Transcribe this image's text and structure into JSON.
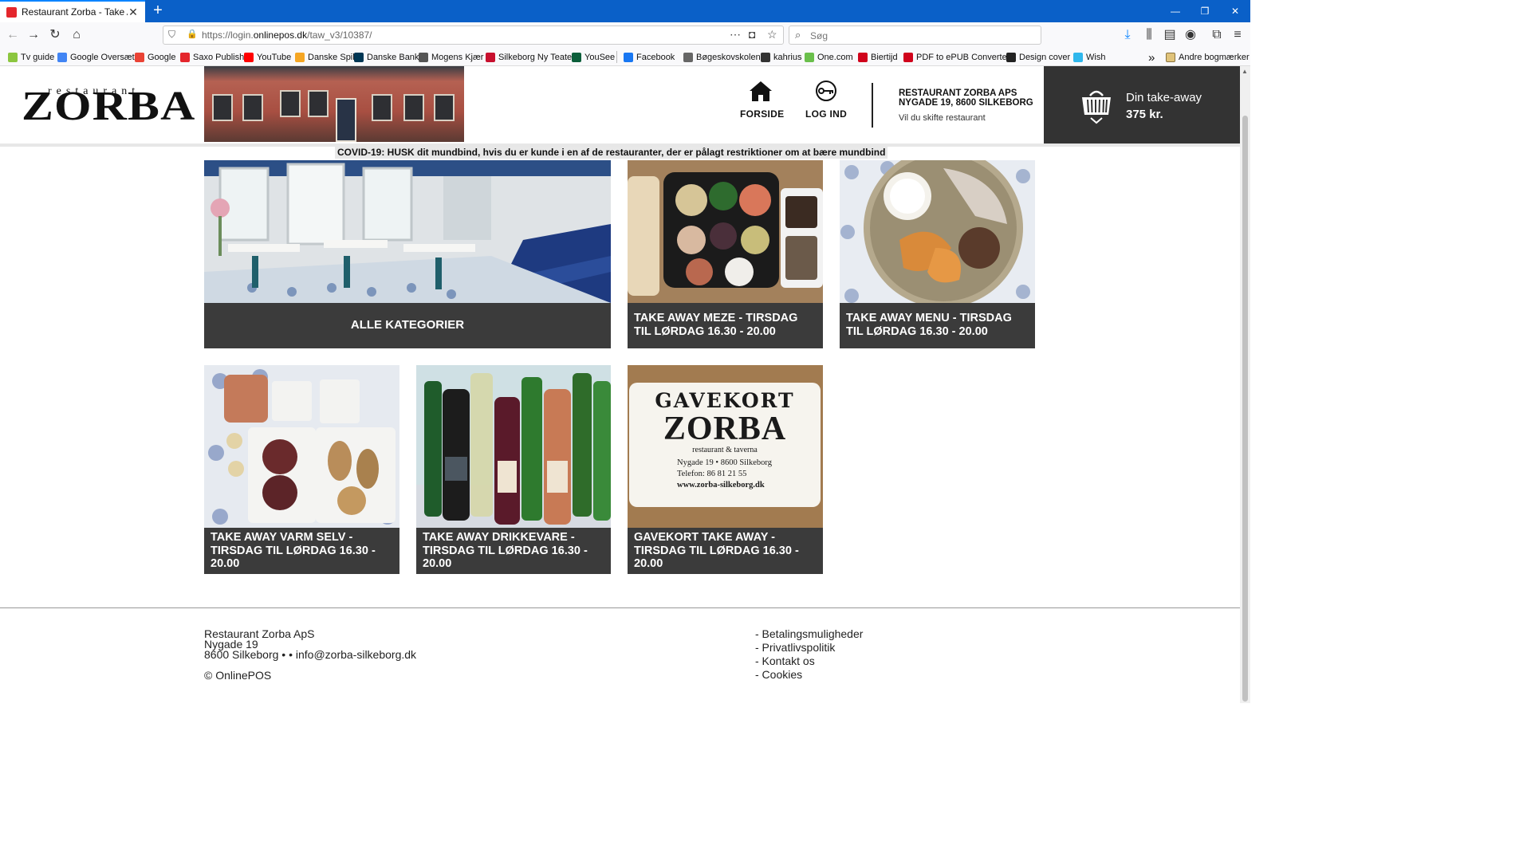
{
  "browser": {
    "tab_title": "Restaurant Zorba - Take Away",
    "url_prefix": "https://login.",
    "url_domain": "onlinepos.dk",
    "url_path": "/taw_v3/10387/",
    "search_placeholder": "Søg",
    "bookmarks": [
      {
        "label": "Tv guide",
        "color": "#8cc63f"
      },
      {
        "label": "Google Oversæt",
        "color": "#4285f4"
      },
      {
        "label": "Google",
        "color": "#ea4335"
      },
      {
        "label": "Saxo Publish",
        "color": "#e4262c"
      },
      {
        "label": "YouTube",
        "color": "#ff0000"
      },
      {
        "label": "Danske Spil",
        "color": "#f5a623"
      },
      {
        "label": "Danske Bank",
        "color": "#003755"
      },
      {
        "label": "Mogens Kjær",
        "color": "#555555"
      },
      {
        "label": "Silkeborg Ny Teater",
        "color": "#c8102e"
      },
      {
        "label": "YouSee",
        "color": "#0b5e3a"
      },
      {
        "label": "Facebook",
        "color": "#1877f2"
      },
      {
        "label": "Bøgeskovskolen",
        "color": "#666666"
      },
      {
        "label": "kahrius",
        "color": "#333333"
      },
      {
        "label": "One.com",
        "color": "#6abf4b"
      },
      {
        "label": "Biertijd",
        "color": "#d0021b"
      },
      {
        "label": "PDF to ePUB Converte...",
        "color": "#d0021b"
      },
      {
        "label": "Design cover",
        "color": "#222222"
      },
      {
        "label": "Wish",
        "color": "#2fb7ec"
      }
    ],
    "other_bookmarks": "Andre bogmærker"
  },
  "header": {
    "logo_small": "restaurant",
    "logo_big": "ZORBA",
    "nav_home": "FORSIDE",
    "nav_login": "LOG IND",
    "restaurant_name": "RESTAURANT ZORBA APS",
    "restaurant_address": "NYGADE 19, 8600 SILKEBORG",
    "change_restaurant": "Vil du skifte restaurant",
    "cart_label": "Din take-away",
    "cart_total": "375 kr."
  },
  "notice": "COVID-19: HUSK dit mundbind, hvis du er kunde i en af de restauranter, der er pålagt restriktioner om at bære mundbind",
  "categories": [
    {
      "title": "ALLE KATEGORIER"
    },
    {
      "title": "TAKE AWAY MEZE - TIRSDAG TIL LØRDAG 16.30 - 20.00"
    },
    {
      "title": "TAKE AWAY MENU - TIRSDAG TIL LØRDAG 16.30 - 20.00"
    },
    {
      "title": "TAKE AWAY VARM SELV - TIRSDAG TIL LØRDAG 16.30 - 20.00"
    },
    {
      "title": "TAKE AWAY DRIKKEVARE - TIRSDAG TIL LØRDAG 16.30 - 20.00"
    },
    {
      "title": "GAVEKORT TAKE AWAY - TIRSDAG TIL LØRDAG 16.30 - 20.00"
    }
  ],
  "giftcard_image": {
    "heading": "GAVEKORT",
    "name": "ZORBA",
    "sub": "restaurant & taverna",
    "line1": "Nygade 19 • 8600 Silkeborg",
    "line2": "Telefon: 86 81 21 55",
    "line3": "www.zorba-silkeborg.dk"
  },
  "footer": {
    "company": "Restaurant Zorba ApS",
    "street": "Nygade 19",
    "city_email": "8600 Silkeborg • • info@zorba-silkeborg.dk",
    "copyright": "© OnlinePOS",
    "links": [
      "- Betalingsmuligheder",
      "- Privatlivspolitik",
      "- Kontakt os",
      "- Cookies"
    ]
  }
}
